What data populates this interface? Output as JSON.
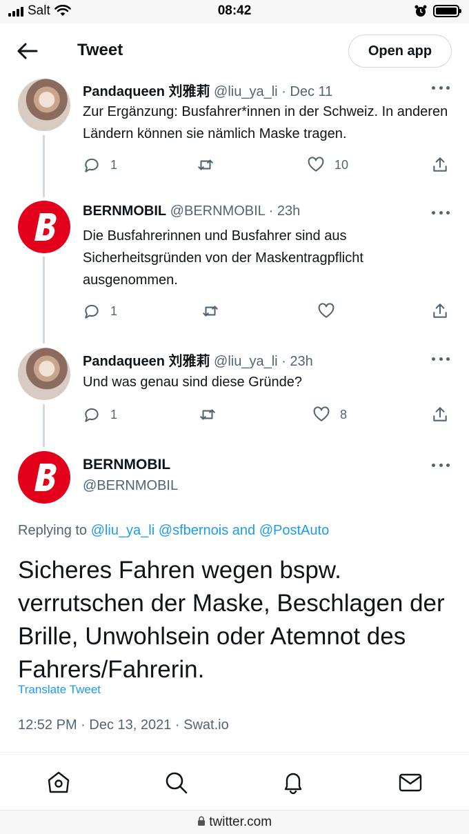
{
  "status_bar": {
    "carrier": "Salt",
    "time": "08:42"
  },
  "header": {
    "title": "Tweet",
    "open_app_label": "Open app"
  },
  "tweets": [
    {
      "name": "Pandaqueen 刘雅莉",
      "handle": "@liu_ya_li",
      "date": "Dec 11",
      "text": "Zur Ergänzung: Busfahrer*innen in der Schweiz. In anderen Ländern können sie nämlich Maske tragen.",
      "replies": "1",
      "retweets": "",
      "likes": "10"
    },
    {
      "name": "BERNMOBIL",
      "handle": "@BERNMOBIL",
      "date": "23h",
      "text": "Die Busfahrerinnen und Busfahrer sind aus Sicherheitsgründen von der Maskentragpflicht ausgenommen.",
      "replies": "1",
      "retweets": "",
      "likes": ""
    },
    {
      "name": "Pandaqueen 刘雅莉",
      "handle": "@liu_ya_li",
      "date": "23h",
      "text": "Und was genau sind diese Gründe?",
      "replies": "1",
      "retweets": "",
      "likes": "8"
    }
  ],
  "main_tweet": {
    "name": "BERNMOBIL",
    "handle": "@BERNMOBIL",
    "replying_prefix": "Replying to",
    "replying_user1": "@liu_ya_li",
    "replying_user2": "@sfbernois",
    "replying_and": "and",
    "replying_user3": "@PostAuto",
    "text": "Sicheres Fahren wegen bspw. verrutschen der Maske, Beschlagen der Brille, Unwohlsein oder Atemnot des Fahrers/Fahrerin.",
    "translate_label": "Translate Tweet",
    "timestamp": "12:52 PM · Dec 13, 2021 · Swat.io"
  },
  "bottom_nav": {
    "items": [
      "home-icon",
      "search-icon",
      "bell-icon",
      "mail-icon"
    ]
  },
  "browser": {
    "url": "twitter.com"
  },
  "colors": {
    "accent": "#1d9bf0",
    "bernmobil_red": "#e2001a",
    "secondary_text": "#536471"
  }
}
